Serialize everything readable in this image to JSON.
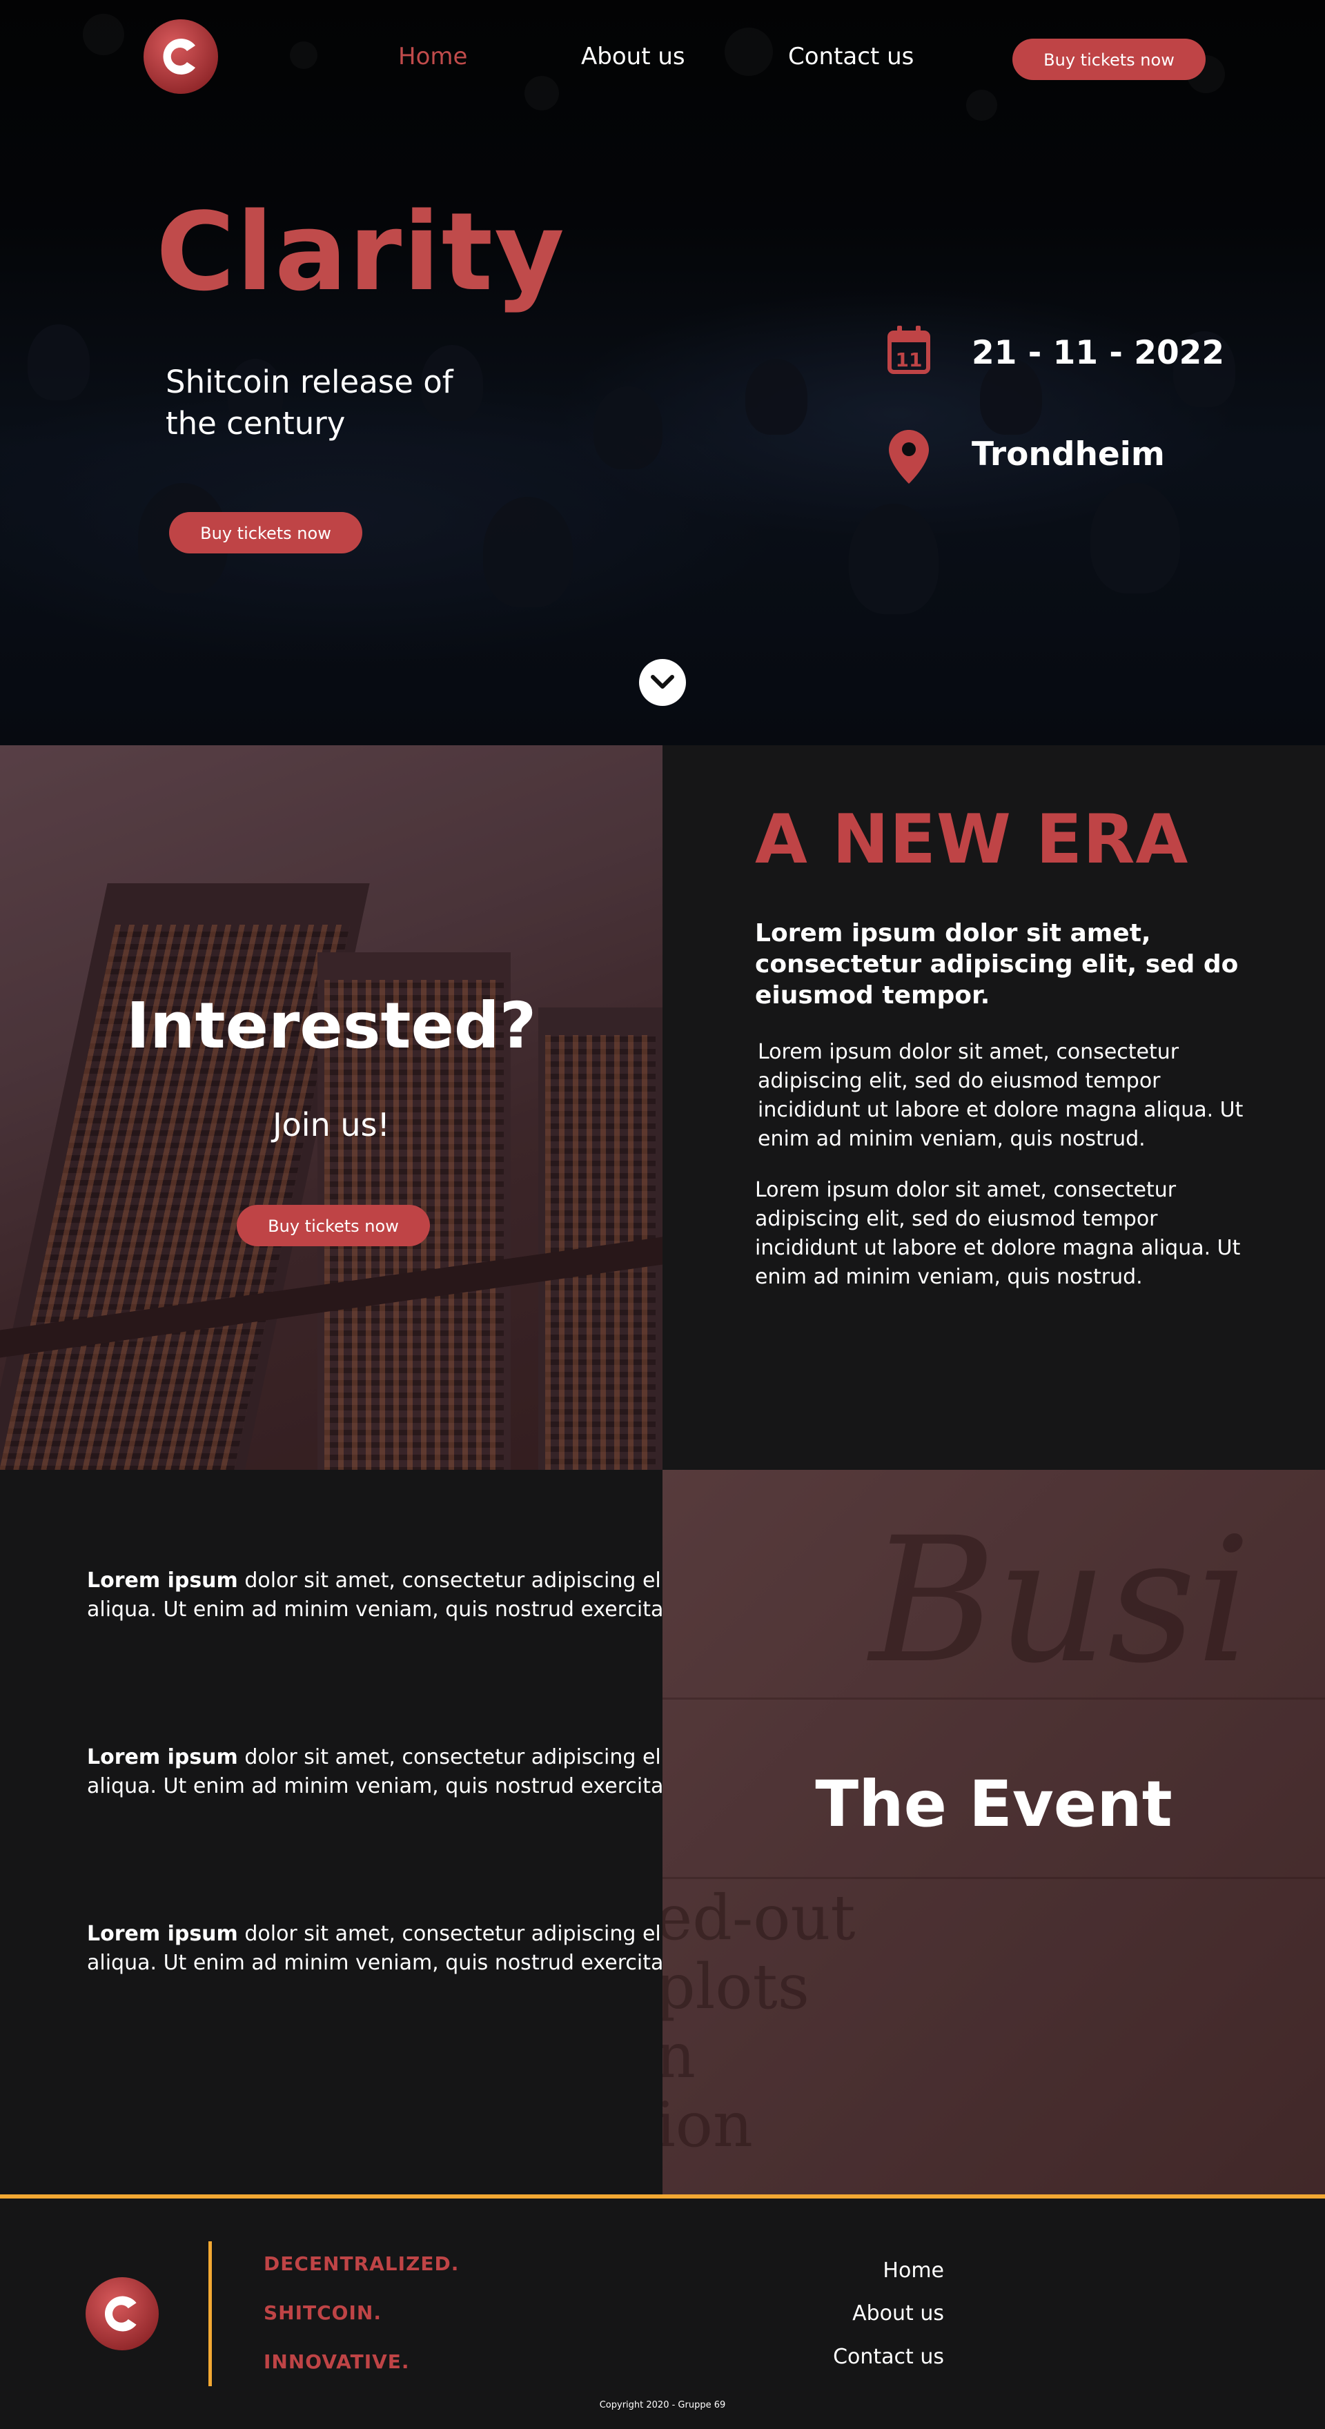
{
  "nav": {
    "links": [
      {
        "label": "Home",
        "active": true
      },
      {
        "label": "About us",
        "active": false
      },
      {
        "label": "Contact us",
        "active": false
      }
    ],
    "cta_label": "Buy tickets now"
  },
  "hero": {
    "title": "Clarity",
    "subtitle": "Shitcoin release of the century",
    "cta_label": "Buy tickets now",
    "date": "21 - 11 - 2022",
    "calendar_day": "11",
    "location": "Trondheim",
    "scroll_icon": "chevron-down-icon"
  },
  "interest": {
    "heading": "Interested?",
    "subheading": "Join us!",
    "cta_label": "Buy tickets now"
  },
  "era": {
    "title": "A NEW ERA",
    "lead": "Lorem ipsum dolor sit amet, consectetur adipiscing elit, sed do eiusmod tempor.",
    "paragraphs": [
      "Lorem ipsum dolor sit amet, consectetur adipiscing elit, sed do eiusmod tempor incididunt ut labore et dolore magna aliqua. Ut enim ad minim veniam, quis nostrud.",
      "Lorem ipsum dolor sit amet, consectetur adipiscing elit, sed do eiusmod tempor incididunt ut labore et dolore magna aliqua. Ut enim ad minim veniam, quis nostrud."
    ]
  },
  "event": {
    "heading": "The Event",
    "blocks": [
      {
        "bold": "Lorem ipsum",
        "text": " dolor sit amet, consectetur adipiscing elit, sed do eiusmod tempor incididunt ut labore et dolore magna aliqua. Ut enim ad minim veniam, quis nostrud exercitation ullamco."
      },
      {
        "bold": "Lorem ipsum",
        "text": " dolor sit amet, consectetur adipiscing elit, sed do eiusmod tempor incididunt ut labore et dolore magna aliqua. Ut enim ad minim veniam, quis nostrud exercitation ullamco."
      },
      {
        "bold": "Lorem ipsum",
        "text": " dolor sit amet, consectetur adipiscing elit, sed do eiusmod tempor incididunt ut labore et dolore magna aliqua. Ut enim ad minim veniam, quis nostrud exercitation ullamco."
      }
    ],
    "newspaper": {
      "masthead": "Busi",
      "lines": [
        "ed-out",
        "plots",
        "n",
        "ion"
      ]
    }
  },
  "footer": {
    "taglines": [
      "DECENTRALIZED.",
      "SHITCOIN.",
      "INNOVATIVE."
    ],
    "links": [
      "Home",
      "About us",
      "Contact us"
    ],
    "copyright": "Copyright 2020 - Gruppe 69"
  },
  "colors": {
    "accent_red": "#bf4446",
    "accent_orange": "#f2a833",
    "panel_dark": "#151516",
    "text": "#ffffff"
  }
}
